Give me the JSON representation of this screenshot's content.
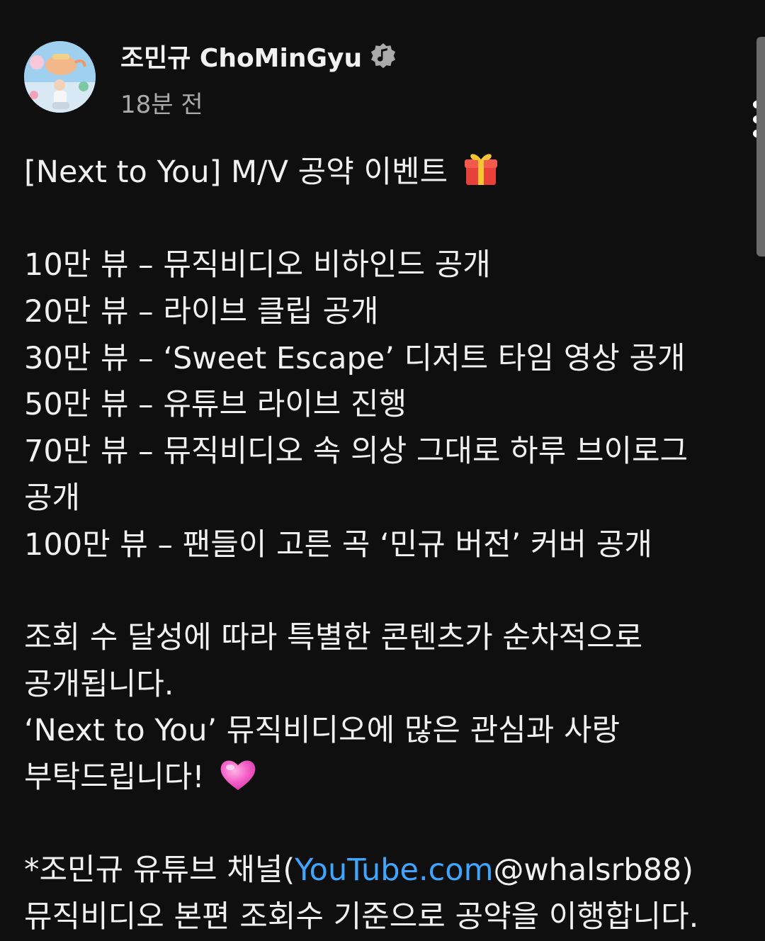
{
  "post": {
    "channel_name": "조민규 ChoMinGyu",
    "timestamp": "18분 전",
    "title": "[Next to You] M/V 공약 이벤트",
    "title_emoji": "gift-icon",
    "milestones": [
      "10만 뷰 – 뮤직비디오 비하인드 공개",
      "20만 뷰 – 라이브 클립 공개",
      "30만 뷰 – ‘Sweet Escape’ 디저트 타임 영상 공개",
      "50만 뷰 – 유튜브 라이브 진행",
      "70만 뷰 – 뮤직비디오 속 의상 그대로 하루 브이로그",
      "공개",
      "100만 뷰 – 팬들이 고른 곡 ‘민규 버전’ 커버 공개"
    ],
    "paragraph_lines": [
      "조회 수 달성에 따라 특별한 콘텐츠가 순차적으로",
      "공개됩니다.",
      "‘Next to You’ 뮤직비디오에 많은 관심과 사랑"
    ],
    "closing_line": "부탁드립니다!",
    "closing_emoji": "pink-heart-icon",
    "note_prefix": "*조민규 유튜브 채널(",
    "note_link": "YouTube.com",
    "note_suffix": "@whalsrb88)",
    "note_line2": "뮤직비디오 본편 조회수 기준으로 공약을 이행합니다."
  },
  "icons": {
    "verified": "music-note-badge-icon",
    "menu": "more-vertical-icon"
  },
  "colors": {
    "background": "#0f0f0f",
    "text": "#f1f1f1",
    "secondary_text": "#aaaaaa",
    "link": "#3ea6ff"
  }
}
